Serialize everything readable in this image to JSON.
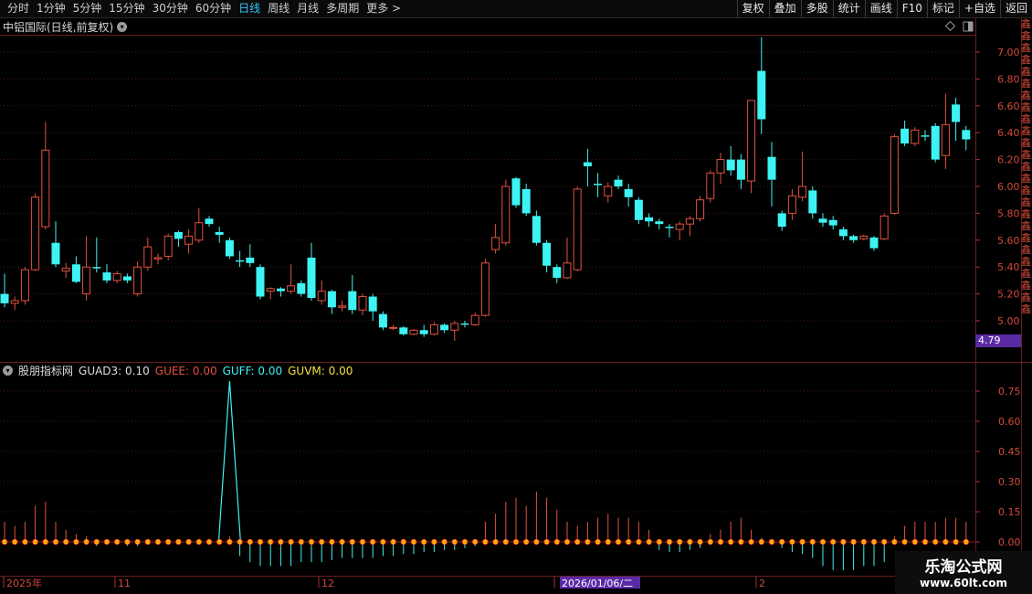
{
  "toolbar": {
    "periods": [
      "分时",
      "1分钟",
      "5分钟",
      "15分钟",
      "30分钟",
      "60分钟",
      "日线",
      "周线",
      "月线",
      "多周期",
      "更多 >"
    ],
    "active_period": "日线",
    "right_buttons": [
      "复权",
      "叠加",
      "多股",
      "统计",
      "画线",
      "F10",
      "标记",
      "+自选",
      "返回"
    ]
  },
  "chart": {
    "title": "中铝国际(日线,前复权)",
    "price_ticks": [
      "7.00",
      "6.80",
      "6.60",
      "6.40",
      "6.20",
      "6.00",
      "5.80",
      "5.60",
      "5.40",
      "5.20",
      "5.00"
    ],
    "current_price": "4.79",
    "up_color": "#e0523f",
    "down_color": "#3ef3f3"
  },
  "indicator": {
    "name": "股朋指标网",
    "guad3": "GUAD3: 0.10",
    "guee": "GUEE: 0.00",
    "guff": "GUFF: 0.00",
    "guvm": "GUVM: 0.00",
    "ticks": [
      "0.75",
      "0.60",
      "0.45",
      "0.30",
      "0.15",
      "0.00"
    ]
  },
  "date_axis": {
    "labels": [
      "2025年",
      "11",
      "12",
      "2026/01/06/二",
      "2"
    ]
  },
  "right_strip": "鑫鑫鑫鑫鑫鑫鑫鑫鑫鑫鑫鑫鑫鑫鑫鑫鑫鑫鑫鑫鑫鑫鑫鑫鑫",
  "watermark": {
    "title": "乐淘公式网",
    "url": "www.60lt.com"
  }
}
